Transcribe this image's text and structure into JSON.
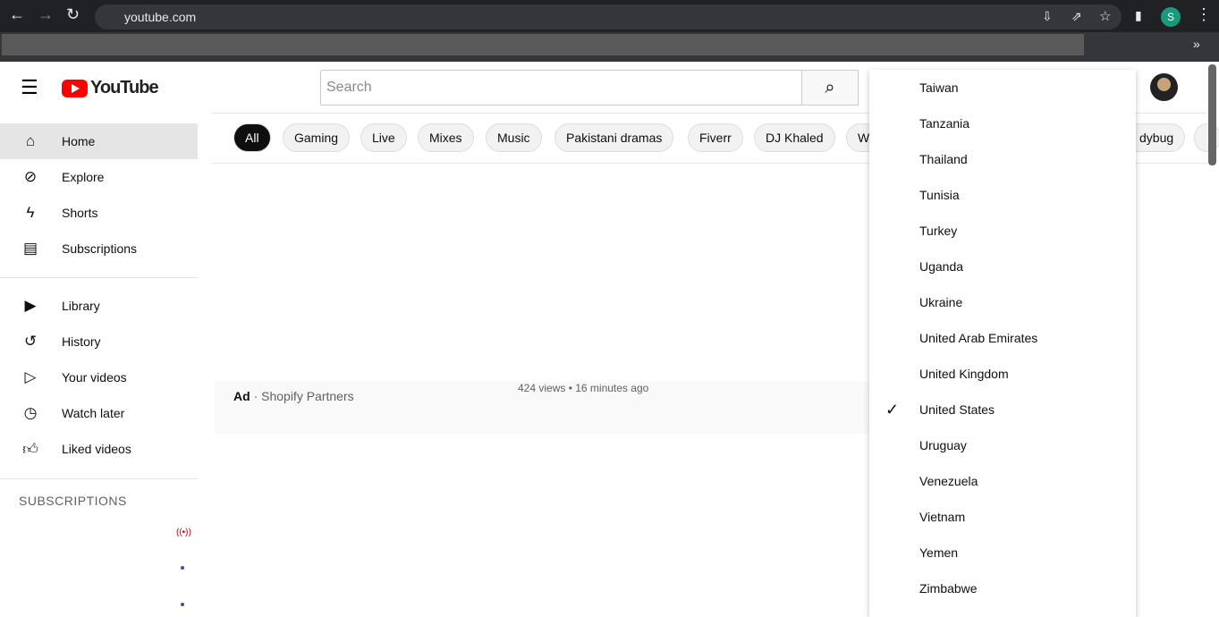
{
  "browser": {
    "url": "youtube.com",
    "profile_initial": "S"
  },
  "youtube": {
    "logo": "YouTube",
    "search_placeholder": "Search",
    "chips": [
      "All",
      "Gaming",
      "Live",
      "Mixes",
      "Music",
      "Pakistani dramas",
      "Fiverr",
      "DJ Khaled",
      "W",
      "dybug"
    ],
    "sidebar": [
      {
        "label": "Home",
        "icon": "home-icon"
      },
      {
        "label": "Explore",
        "icon": "compass-icon"
      },
      {
        "label": "Shorts",
        "icon": "shorts-icon"
      },
      {
        "label": "Subscriptions",
        "icon": "subscriptions-icon"
      },
      {
        "label": "Library",
        "icon": "library-icon"
      },
      {
        "label": "History",
        "icon": "history-icon"
      },
      {
        "label": "Your videos",
        "icon": "your-videos-icon"
      },
      {
        "label": "Watch later",
        "icon": "clock-icon"
      },
      {
        "label": "Liked videos",
        "icon": "thumbs-up-icon"
      }
    ],
    "subscriptions_heading": "SUBSCRIPTIONS",
    "ad": {
      "badge": "Ad",
      "sep": "·",
      "advertiser": "Shopify Partners",
      "meta": "424 views • 16 minutes ago"
    },
    "location_menu": {
      "items": [
        "Taiwan",
        "Tanzania",
        "Thailand",
        "Tunisia",
        "Turkey",
        "Uganda",
        "Ukraine",
        "United Arab Emirates",
        "United Kingdom",
        "United States",
        "Uruguay",
        "Venezuela",
        "Vietnam",
        "Yemen",
        "Zimbabwe"
      ],
      "selected": "United States"
    }
  }
}
